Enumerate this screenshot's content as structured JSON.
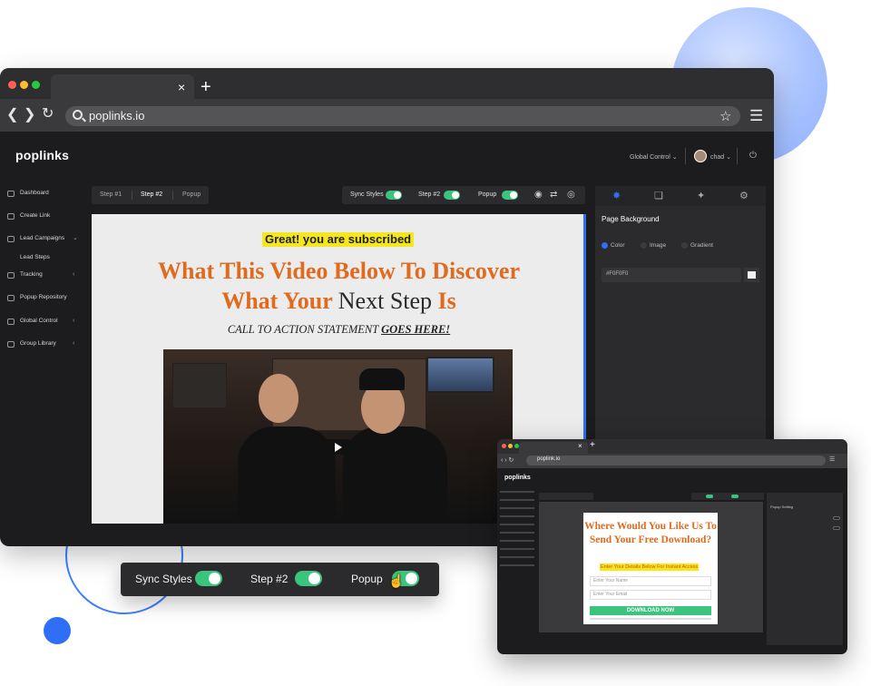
{
  "browser": {
    "url": "poplinks.io",
    "close_tab": "×",
    "new_tab": "+"
  },
  "app": {
    "logo": "poplinks",
    "header": {
      "global_control": "Global Control",
      "user": "chad"
    },
    "sidebar": [
      {
        "label": "Dashboard"
      },
      {
        "label": "Create Link"
      },
      {
        "label": "Lead Campaigns"
      },
      {
        "label": "Lead Steps"
      },
      {
        "label": "Tracking"
      },
      {
        "label": "Popup Repository"
      },
      {
        "label": "Global Control"
      },
      {
        "label": "Group Library"
      }
    ],
    "step_tabs": [
      "Step #1",
      "Step #2",
      "Popup"
    ],
    "controls": {
      "sync_styles": "Sync Styles",
      "step": "Step #2",
      "popup": "Popup"
    },
    "canvas": {
      "badge": "Great! you are subscribed",
      "headline_line1": "What This Video Below To Discover",
      "headline_line2_a": "What Your",
      "headline_line2_b": "Next Step",
      "headline_line2_c": "Is",
      "cta_text": "CALL TO ACTION STATEMENT",
      "cta_link": "GOES HERE!"
    },
    "right_panel": {
      "title": "Page Background",
      "options": [
        "Color",
        "Image",
        "Gradient"
      ],
      "selected_option": "Color",
      "hex_value": "#F0F0F0",
      "swatch_color": "#f0f0f0"
    }
  },
  "toggle_strip": {
    "sync_styles": "Sync Styles",
    "step": "Step #2",
    "popup": "Popup"
  },
  "preview_browser": {
    "url": "poplink.io",
    "logo": "poplinks",
    "popup": {
      "title": "Where Would You Like Us To Send Your Free Download?",
      "highlight": "Enter Your Details Below For Instant Access",
      "name_placeholder": "Enter Your Name",
      "email_placeholder": "Enter Your Email",
      "button": "DOWNLOAD NOW"
    },
    "panel_title": "Popup Setting"
  },
  "colors": {
    "accent": "#2f6ef5",
    "toggle_on": "#3ac47d",
    "headline_orange": "#e06a1e",
    "highlight_yellow": "#f5e61f"
  }
}
